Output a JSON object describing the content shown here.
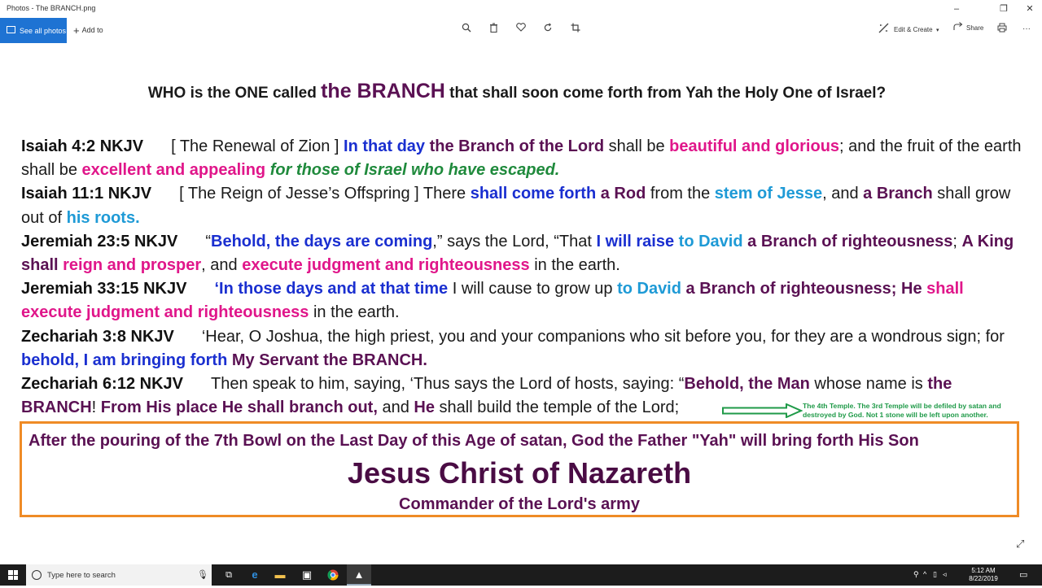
{
  "window": {
    "title": "Photos - The BRANCH.png",
    "minimize": "–",
    "maximize": "❐",
    "close": "✕"
  },
  "toolbar": {
    "see_all_photos": "See all photos",
    "add_to": "Add to",
    "edit_create": "Edit & Create",
    "share": "Share",
    "more": "···",
    "icons": [
      "zoom-icon",
      "delete-icon",
      "favorite-icon",
      "rotate-icon",
      "crop-icon",
      "print-icon"
    ]
  },
  "image": {
    "heading_part1": "WHO is the ONE called ",
    "heading_big": "the BRANCH",
    "heading_part2": " that shall soon come forth from Yah the Holy One of Israel?",
    "verses": [
      {
        "ref": "Isaiah 4:2 NKJV",
        "segments": [
          {
            "t": "[ The Renewal of Zion ] ",
            "c": ""
          },
          {
            "t": "In that day",
            "c": "blue"
          },
          {
            "t": " ",
            "c": ""
          },
          {
            "t": "the Branch of the Lord",
            "c": "plum"
          },
          {
            "t": " shall be ",
            "c": ""
          },
          {
            "t": "beautiful and glorious",
            "c": "mag"
          },
          {
            "t": "; and the fruit of the earth shall be ",
            "c": ""
          },
          {
            "t": "excellent and appealing",
            "c": "mag"
          },
          {
            "t": " ",
            "c": ""
          },
          {
            "t": "for those of Israel who have escaped.",
            "c": "green"
          }
        ]
      },
      {
        "ref": "Isaiah 11:1 NKJV",
        "segments": [
          {
            "t": "[ The Reign of Jesse’s Offspring ] There ",
            "c": ""
          },
          {
            "t": "shall come forth",
            "c": "blue"
          },
          {
            "t": " ",
            "c": ""
          },
          {
            "t": "a Rod",
            "c": "plum"
          },
          {
            "t": " from the ",
            "c": ""
          },
          {
            "t": "stem of Jesse",
            "c": "cyan"
          },
          {
            "t": ", and ",
            "c": ""
          },
          {
            "t": "a Branch",
            "c": "plum"
          },
          {
            "t": " shall grow out of ",
            "c": ""
          },
          {
            "t": "his roots.",
            "c": "cyan"
          }
        ]
      },
      {
        "ref": "Jeremiah 23:5 NKJV",
        "segments": [
          {
            "t": "“",
            "c": ""
          },
          {
            "t": "Behold, the days are coming",
            "c": "blue"
          },
          {
            "t": ",” says the Lord, “That ",
            "c": ""
          },
          {
            "t": "I will raise",
            "c": "blue"
          },
          {
            "t": " ",
            "c": ""
          },
          {
            "t": "to David",
            "c": "cyan"
          },
          {
            "t": " ",
            "c": ""
          },
          {
            "t": "a Branch of righteousness",
            "c": "plum"
          },
          {
            "t": "; ",
            "c": ""
          },
          {
            "t": "A King shall",
            "c": "plum"
          },
          {
            "t": " ",
            "c": ""
          },
          {
            "t": "reign and prosper",
            "c": "mag"
          },
          {
            "t": ", and ",
            "c": ""
          },
          {
            "t": "execute judgment and righteousness",
            "c": "mag"
          },
          {
            "t": " in the earth.",
            "c": ""
          }
        ]
      },
      {
        "ref": "Jeremiah 33:15 NKJV",
        "segments": [
          {
            "t": "‘",
            "c": "blue"
          },
          {
            "t": "In those days and at that time",
            "c": "blue"
          },
          {
            "t": " I will cause to grow up ",
            "c": ""
          },
          {
            "t": "to David",
            "c": "cyan"
          },
          {
            "t": " ",
            "c": ""
          },
          {
            "t": "a Branch of righteousness; He",
            "c": "plum"
          },
          {
            "t": " ",
            "c": ""
          },
          {
            "t": "shall execute judgment and righteousness",
            "c": "mag"
          },
          {
            "t": " in the earth.",
            "c": ""
          }
        ]
      },
      {
        "ref": "Zechariah 3:8 NKJV",
        "segments": [
          {
            "t": "‘Hear, O Joshua, the high priest, you and your companions who sit before you, for they are a wondrous sign; for ",
            "c": ""
          },
          {
            "t": "behold, I am bringing forth",
            "c": "blue"
          },
          {
            "t": " ",
            "c": ""
          },
          {
            "t": "My Servant the BRANCH.",
            "c": "plum"
          }
        ]
      },
      {
        "ref": "Zechariah 6:12 NKJV",
        "segments": [
          {
            "t": "Then speak to him, saying, ‘Thus says the Lord of hosts, saying: “",
            "c": ""
          },
          {
            "t": "Behold, the Man",
            "c": "plum"
          },
          {
            "t": " whose name is ",
            "c": ""
          },
          {
            "t": "the BRANCH",
            "c": "plum"
          },
          {
            "t": "! ",
            "c": ""
          },
          {
            "t": "From His place He",
            "c": "plum"
          },
          {
            "t": " ",
            "c": ""
          },
          {
            "t": "shall branch out,",
            "c": "plum"
          },
          {
            "t": " and ",
            "c": ""
          },
          {
            "t": "He",
            "c": "plum"
          },
          {
            "t": " shall build the temple of the Lord;",
            "c": ""
          }
        ]
      }
    ],
    "note": "The 4th Temple. The 3rd Temple will be defiled by satan and destroyed by God. Not 1 stone will be left upon another.",
    "box_line1": "After the pouring of the 7th Bowl on the Last Day of this Age of satan, God the Father \"Yah\" will bring forth His Son",
    "box_name": "Jesus Christ of Nazareth",
    "box_cmd": "Commander of the Lord's army"
  },
  "taskbar": {
    "search_placeholder": "Type here to search",
    "time": "5:12 AM",
    "date": "8/22/2019"
  },
  "colors": {
    "accent": "#1e73d3",
    "blue": "#1a2fd0",
    "cyan": "#1e9ad6",
    "magenta": "#e0168a",
    "plum": "#5a1153",
    "green": "#1f8a3c",
    "orange_border": "#ef8b26"
  }
}
